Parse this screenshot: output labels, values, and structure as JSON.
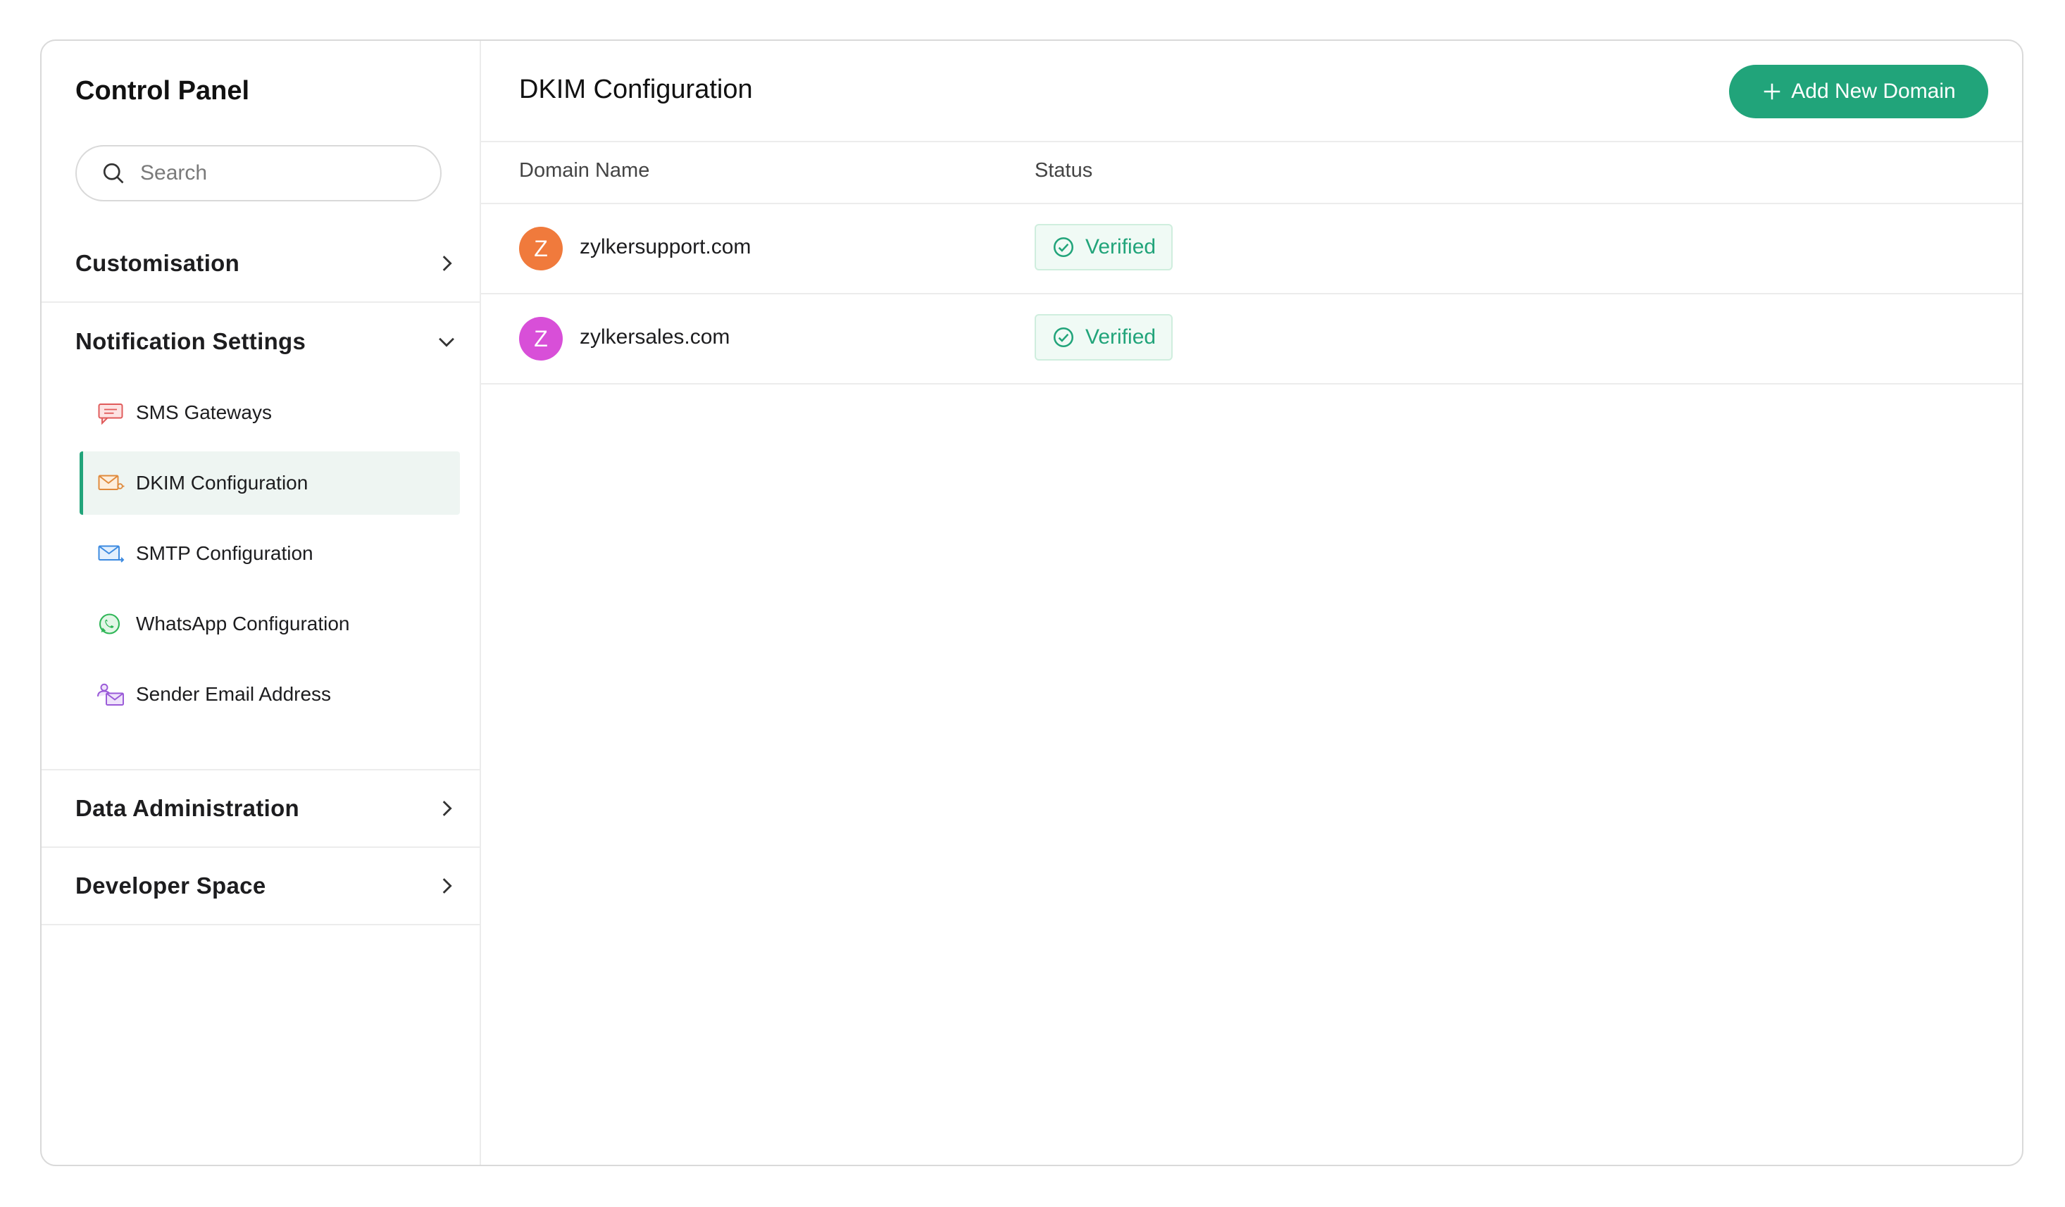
{
  "sidebar": {
    "title": "Control Panel",
    "search": {
      "placeholder": "Search",
      "value": ""
    },
    "sections": [
      {
        "label": "Customisation",
        "state": "collapsed"
      },
      {
        "label": "Notification Settings",
        "state": "expanded"
      },
      {
        "label": "Data Administration",
        "state": "collapsed"
      },
      {
        "label": "Developer Space",
        "state": "collapsed"
      }
    ],
    "notification_items": [
      {
        "label": "SMS Gateways",
        "icon": "sms-gateway-icon"
      },
      {
        "label": "DKIM Configuration",
        "icon": "dkim-mail-icon",
        "active": true
      },
      {
        "label": "SMTP Configuration",
        "icon": "smtp-mail-icon"
      },
      {
        "label": "WhatsApp Configuration",
        "icon": "whatsapp-icon"
      },
      {
        "label": "Sender Email Address",
        "icon": "sender-email-icon"
      }
    ]
  },
  "main": {
    "title": "DKIM Configuration",
    "add_button_label": "Add New Domain",
    "columns": [
      "Domain Name",
      "Status"
    ],
    "rows": [
      {
        "initial": "Z",
        "domain": "zylkersupport.com",
        "status": "Verified",
        "avatar_color": "#f07a3c"
      },
      {
        "initial": "Z",
        "domain": "zylkersales.com",
        "status": "Verified",
        "avatar_color": "#d84fd8"
      }
    ]
  },
  "colors": {
    "accent": "#21a47a",
    "active_bg": "#eef5f2",
    "verified_bg": "#f0faf5"
  }
}
